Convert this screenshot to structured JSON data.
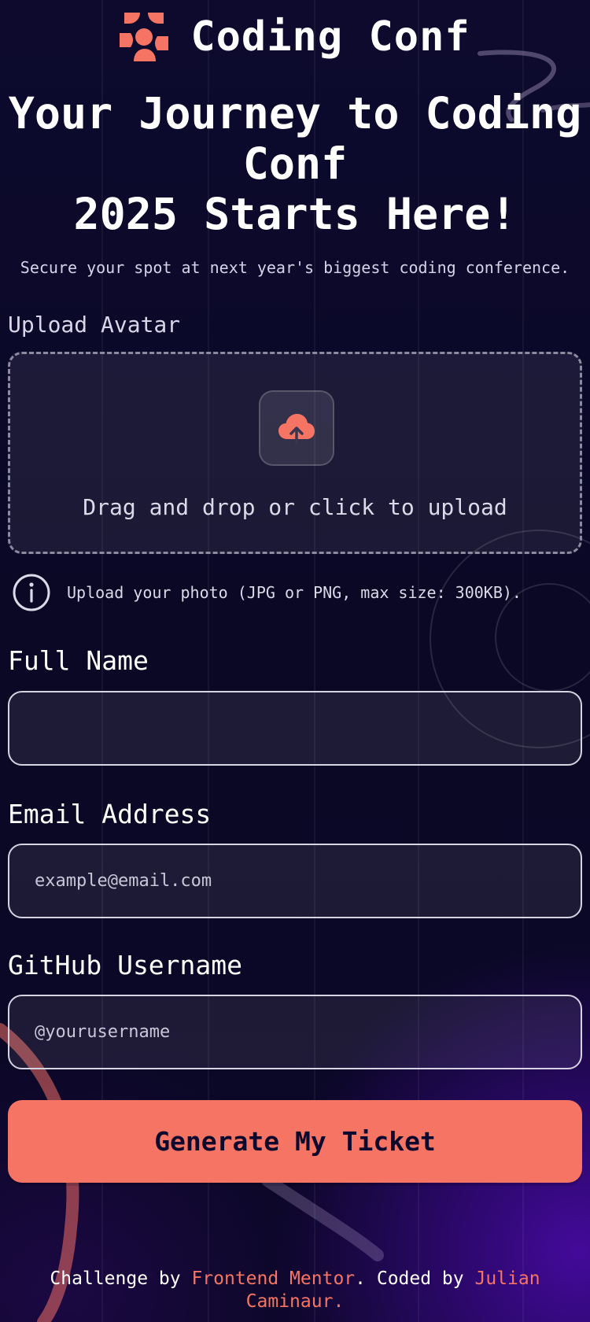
{
  "colors": {
    "accent": "#f57463",
    "background": "#0b0726",
    "text": "#ffffff",
    "muted": "#dcdae8"
  },
  "header": {
    "logo_icon": "coding-conf-logo-icon",
    "logo_text": "Coding Conf"
  },
  "hero": {
    "title_line1": "Your Journey to Coding",
    "title_line2": "Conf",
    "title_line3": "2025 Starts Here!",
    "subtitle": "Secure your spot at next year's biggest coding conference."
  },
  "form": {
    "avatar": {
      "label": "Upload Avatar",
      "icon": "cloud-upload-icon",
      "upload_text": "Drag and drop or click to upload",
      "hint_icon": "info-icon",
      "hint_text": "Upload your photo (JPG or PNG, max size: 300KB)."
    },
    "full_name": {
      "label": "Full Name",
      "value": "",
      "placeholder": ""
    },
    "email": {
      "label": "Email Address",
      "value": "",
      "placeholder": "example@email.com"
    },
    "github": {
      "label": "GitHub Username",
      "value": "",
      "placeholder": "@yourusername"
    },
    "submit_label": "Generate My Ticket"
  },
  "footer": {
    "prefix": "Challenge by ",
    "link1": "Frontend Mentor",
    "middle": ". Coded by ",
    "link2": "Julian Caminaur",
    "suffix": "."
  }
}
